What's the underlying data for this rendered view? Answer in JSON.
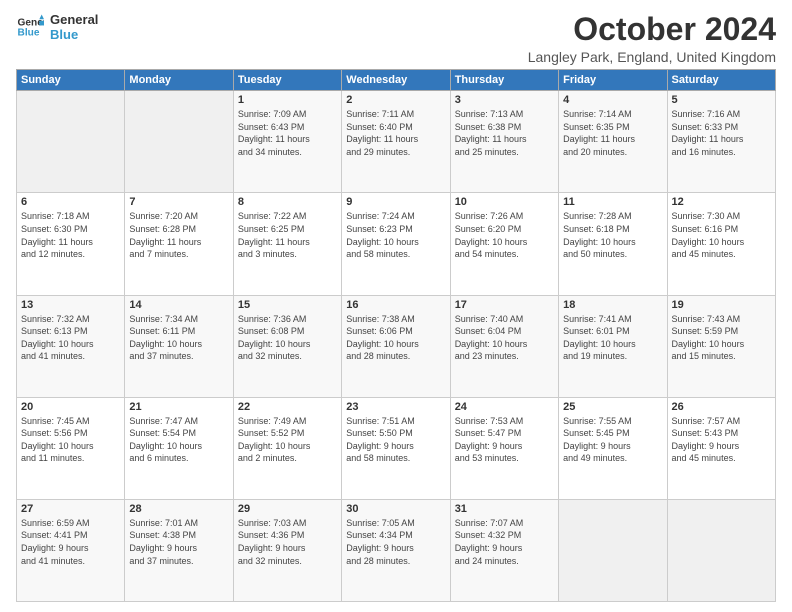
{
  "logo": {
    "line1": "General",
    "line2": "Blue"
  },
  "title": "October 2024",
  "subtitle": "Langley Park, England, United Kingdom",
  "days_of_week": [
    "Sunday",
    "Monday",
    "Tuesday",
    "Wednesday",
    "Thursday",
    "Friday",
    "Saturday"
  ],
  "weeks": [
    [
      {
        "day": "",
        "info": ""
      },
      {
        "day": "",
        "info": ""
      },
      {
        "day": "1",
        "info": "Sunrise: 7:09 AM\nSunset: 6:43 PM\nDaylight: 11 hours\nand 34 minutes."
      },
      {
        "day": "2",
        "info": "Sunrise: 7:11 AM\nSunset: 6:40 PM\nDaylight: 11 hours\nand 29 minutes."
      },
      {
        "day": "3",
        "info": "Sunrise: 7:13 AM\nSunset: 6:38 PM\nDaylight: 11 hours\nand 25 minutes."
      },
      {
        "day": "4",
        "info": "Sunrise: 7:14 AM\nSunset: 6:35 PM\nDaylight: 11 hours\nand 20 minutes."
      },
      {
        "day": "5",
        "info": "Sunrise: 7:16 AM\nSunset: 6:33 PM\nDaylight: 11 hours\nand 16 minutes."
      }
    ],
    [
      {
        "day": "6",
        "info": "Sunrise: 7:18 AM\nSunset: 6:30 PM\nDaylight: 11 hours\nand 12 minutes."
      },
      {
        "day": "7",
        "info": "Sunrise: 7:20 AM\nSunset: 6:28 PM\nDaylight: 11 hours\nand 7 minutes."
      },
      {
        "day": "8",
        "info": "Sunrise: 7:22 AM\nSunset: 6:25 PM\nDaylight: 11 hours\nand 3 minutes."
      },
      {
        "day": "9",
        "info": "Sunrise: 7:24 AM\nSunset: 6:23 PM\nDaylight: 10 hours\nand 58 minutes."
      },
      {
        "day": "10",
        "info": "Sunrise: 7:26 AM\nSunset: 6:20 PM\nDaylight: 10 hours\nand 54 minutes."
      },
      {
        "day": "11",
        "info": "Sunrise: 7:28 AM\nSunset: 6:18 PM\nDaylight: 10 hours\nand 50 minutes."
      },
      {
        "day": "12",
        "info": "Sunrise: 7:30 AM\nSunset: 6:16 PM\nDaylight: 10 hours\nand 45 minutes."
      }
    ],
    [
      {
        "day": "13",
        "info": "Sunrise: 7:32 AM\nSunset: 6:13 PM\nDaylight: 10 hours\nand 41 minutes."
      },
      {
        "day": "14",
        "info": "Sunrise: 7:34 AM\nSunset: 6:11 PM\nDaylight: 10 hours\nand 37 minutes."
      },
      {
        "day": "15",
        "info": "Sunrise: 7:36 AM\nSunset: 6:08 PM\nDaylight: 10 hours\nand 32 minutes."
      },
      {
        "day": "16",
        "info": "Sunrise: 7:38 AM\nSunset: 6:06 PM\nDaylight: 10 hours\nand 28 minutes."
      },
      {
        "day": "17",
        "info": "Sunrise: 7:40 AM\nSunset: 6:04 PM\nDaylight: 10 hours\nand 23 minutes."
      },
      {
        "day": "18",
        "info": "Sunrise: 7:41 AM\nSunset: 6:01 PM\nDaylight: 10 hours\nand 19 minutes."
      },
      {
        "day": "19",
        "info": "Sunrise: 7:43 AM\nSunset: 5:59 PM\nDaylight: 10 hours\nand 15 minutes."
      }
    ],
    [
      {
        "day": "20",
        "info": "Sunrise: 7:45 AM\nSunset: 5:56 PM\nDaylight: 10 hours\nand 11 minutes."
      },
      {
        "day": "21",
        "info": "Sunrise: 7:47 AM\nSunset: 5:54 PM\nDaylight: 10 hours\nand 6 minutes."
      },
      {
        "day": "22",
        "info": "Sunrise: 7:49 AM\nSunset: 5:52 PM\nDaylight: 10 hours\nand 2 minutes."
      },
      {
        "day": "23",
        "info": "Sunrise: 7:51 AM\nSunset: 5:50 PM\nDaylight: 9 hours\nand 58 minutes."
      },
      {
        "day": "24",
        "info": "Sunrise: 7:53 AM\nSunset: 5:47 PM\nDaylight: 9 hours\nand 53 minutes."
      },
      {
        "day": "25",
        "info": "Sunrise: 7:55 AM\nSunset: 5:45 PM\nDaylight: 9 hours\nand 49 minutes."
      },
      {
        "day": "26",
        "info": "Sunrise: 7:57 AM\nSunset: 5:43 PM\nDaylight: 9 hours\nand 45 minutes."
      }
    ],
    [
      {
        "day": "27",
        "info": "Sunrise: 6:59 AM\nSunset: 4:41 PM\nDaylight: 9 hours\nand 41 minutes."
      },
      {
        "day": "28",
        "info": "Sunrise: 7:01 AM\nSunset: 4:38 PM\nDaylight: 9 hours\nand 37 minutes."
      },
      {
        "day": "29",
        "info": "Sunrise: 7:03 AM\nSunset: 4:36 PM\nDaylight: 9 hours\nand 32 minutes."
      },
      {
        "day": "30",
        "info": "Sunrise: 7:05 AM\nSunset: 4:34 PM\nDaylight: 9 hours\nand 28 minutes."
      },
      {
        "day": "31",
        "info": "Sunrise: 7:07 AM\nSunset: 4:32 PM\nDaylight: 9 hours\nand 24 minutes."
      },
      {
        "day": "",
        "info": ""
      },
      {
        "day": "",
        "info": ""
      }
    ]
  ]
}
